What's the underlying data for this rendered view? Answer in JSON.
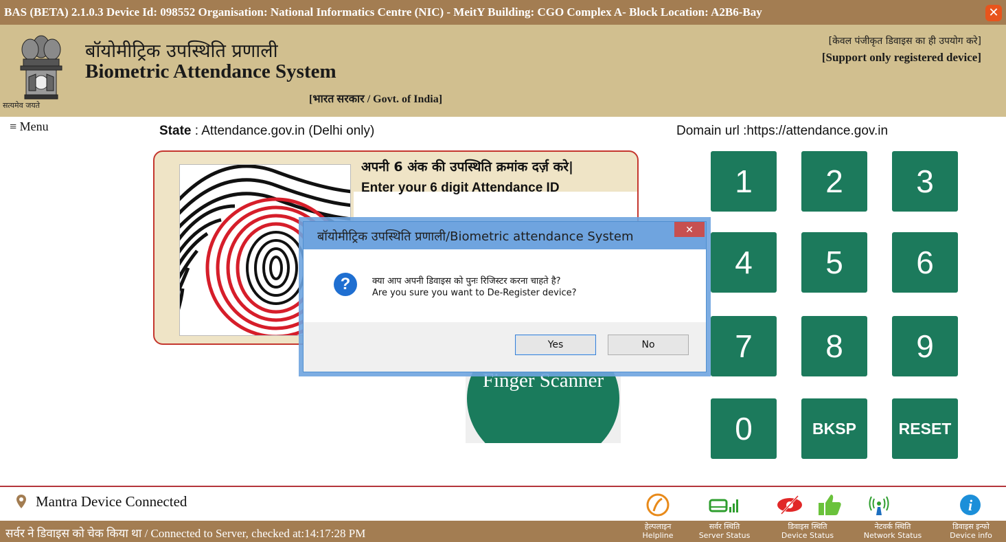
{
  "window": {
    "title": "BAS (BETA) 2.1.0.3 Device Id: 098552 Organisation: National Informatics Centre (NIC) - MeitY Building: CGO Complex A- Block  Location: A2B6-Bay",
    "close_glyph": "✕"
  },
  "header": {
    "motto": "सत्यमेव जयते",
    "title_hindi": "बॉयोमीट्रिक उपस्थिति प्रणाली",
    "title_english": "Biometric Attendance System",
    "govt": "[भारत सरकार / Govt. of India]",
    "support_hindi": "[केवल पंजीकृत डिवाइस का ही उपयोग करे]",
    "support_english": "[Support only registered device]"
  },
  "nav": {
    "menu_label": "≡ Menu",
    "state_label": "State",
    "state_value": " : Attendance.gov.in (Delhi only)",
    "domain": "Domain url :https://attendance.gov.in"
  },
  "attendance": {
    "prompt_hindi": "अपनी 6 अंक की उपस्थिति क्रमांक दर्ज़ करे|",
    "prompt_english": "Enter your 6 digit Attendance ID"
  },
  "scanner": {
    "label": "Finger Scanner"
  },
  "keypad": {
    "keys": [
      "1",
      "2",
      "3",
      "4",
      "5",
      "6",
      "7",
      "8",
      "9",
      "0",
      "BKSP",
      "RESET"
    ]
  },
  "dialog": {
    "title": "बॉयोमीट्रिक उपस्थिति प्रणाली/Biometric attendance System",
    "close_glyph": "✕",
    "icon_glyph": "?",
    "message_hindi": "क्या आप अपनी डिवाइस को पुनः रिजिस्टर करना चाहते है?",
    "message_english": "Are you sure you want to De-Register device?",
    "yes_label": "Yes",
    "no_label": "No"
  },
  "status": {
    "device_connected": "Mantra Device Connected",
    "server_check": "सर्वर ने डिवाइस को चेक किया था / Connected to Server, checked at:14:17:28 PM",
    "items": [
      {
        "hindi": "हेल्पलाइन",
        "english": "Helpline",
        "icon": "helpline-icon"
      },
      {
        "hindi": "सर्वर स्थिति",
        "english": "Server Status",
        "icon": "server-status-icon"
      },
      {
        "hindi": "डिवाइस स्थिति",
        "english": "Device Status",
        "icon": "device-status-icon"
      },
      {
        "hindi": "नेटवर्क स्थिति",
        "english": "Network Status",
        "icon": "network-status-icon"
      },
      {
        "hindi": "डिवाइस इन्फो",
        "english": "Device info",
        "icon": "device-info-icon"
      }
    ]
  },
  "colors": {
    "titlebar": "#a37d52",
    "header": "#d1bf8f",
    "keypad": "#1c7a5c",
    "accent_red": "#c4362e",
    "dialog_title": "#6fa4df"
  }
}
